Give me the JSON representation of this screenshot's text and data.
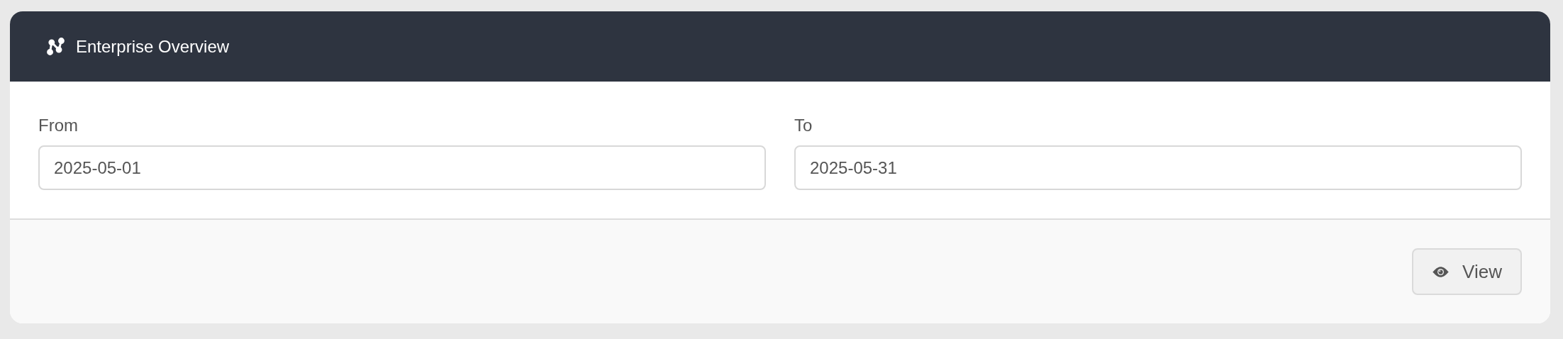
{
  "header": {
    "title": "Enterprise Overview"
  },
  "fields": [
    {
      "label": "From",
      "value": "2025-05-01"
    },
    {
      "label": "To",
      "value": "2025-05-31"
    }
  ],
  "footer": {
    "button": "View"
  }
}
